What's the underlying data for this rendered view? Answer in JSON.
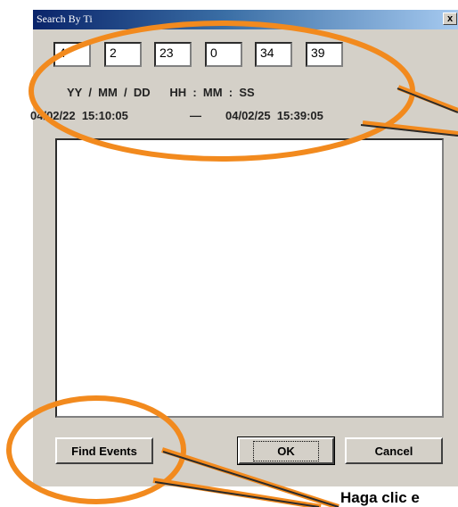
{
  "dialog": {
    "title": "Search By Ti",
    "close_label": "x",
    "fields": [
      "4",
      "2",
      "23",
      "0",
      "34",
      "39"
    ],
    "format_label": "YY  /  MM  /  DD      HH  :  MM  :  SS",
    "range_start": "04/02/22  15:10:05",
    "range_separator": "—",
    "range_end": "04/02/25  15:39:05",
    "buttons": {
      "find_events": "Find Events",
      "ok": "OK",
      "cancel": "Cancel"
    }
  },
  "caption": "Haga clic e"
}
